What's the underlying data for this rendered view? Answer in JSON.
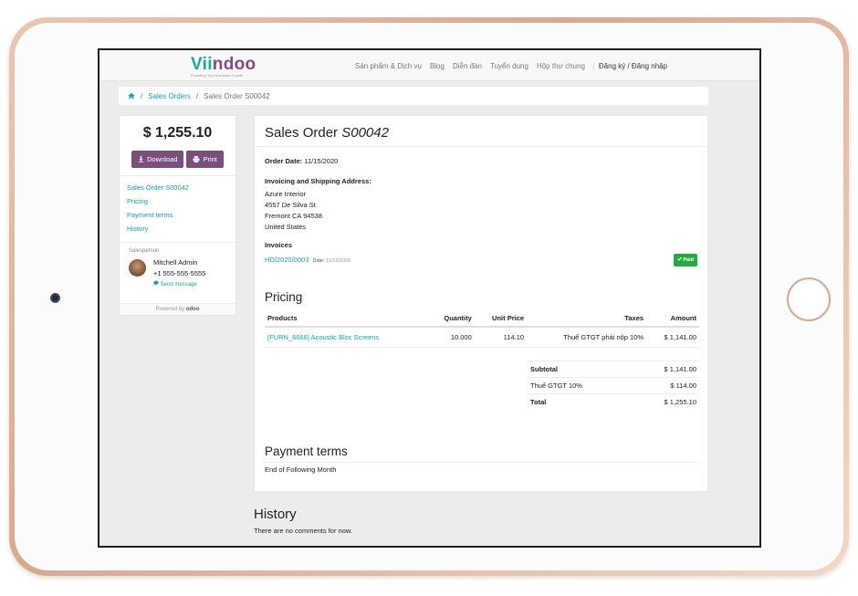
{
  "nav": {
    "logo": "Viindoo",
    "tagline": "Providing Your Business Growth",
    "links": [
      "Sản phẩm & Dịch vụ",
      "Blog",
      "Diễn đàn",
      "Tuyển dụng",
      "Hộp thư chung"
    ],
    "login": "Đăng ký / Đăng nhập"
  },
  "breadcrumb": {
    "home_icon": "home-icon",
    "items": [
      "Sales Orders",
      "Sales Order S00042"
    ]
  },
  "sidebar": {
    "amount": "$ 1,255.10",
    "download_label": "Download",
    "print_label": "Print",
    "links": [
      "Sales Order S00042",
      "Pricing",
      "Payment terms",
      "History"
    ],
    "salesperson_label": "Salesperson",
    "salesperson_name": "Mitchell Admin",
    "salesperson_phone": "+1 555-555-5555",
    "send_message": "Send message",
    "powered_by": "Powered by",
    "powered_brand": "odoo"
  },
  "order": {
    "title_prefix": "Sales Order",
    "number": "S00042",
    "order_date_label": "Order Date:",
    "order_date": "11/15/2020",
    "address_label": "Invoicing and Shipping Address:",
    "address_lines": [
      "Azure Interior",
      "4557 De Silva St",
      "Fremont CA 94538",
      "United States"
    ],
    "invoices_label": "Invoices",
    "invoice_number": "HD/2020/0003",
    "invoice_date_label": "Date:",
    "invoice_date": "11/15/2020",
    "invoice_status": "Paid"
  },
  "pricing": {
    "title": "Pricing",
    "headers": [
      "Products",
      "Quantity",
      "Unit Price",
      "Taxes",
      "Amount"
    ],
    "rows": [
      {
        "product": "[FURN_6666] Acoustic Bloc Screens",
        "quantity": "10.000",
        "unit_price": "114.10",
        "taxes": "Thuế GTGT phải nộp 10%",
        "amount": "$ 1,141.00"
      }
    ],
    "subtotal_label": "Subtotal",
    "subtotal": "$ 1,141.00",
    "tax_label": "Thuế GTGT 10%",
    "tax": "$ 114.00",
    "total_label": "Total",
    "total": "$ 1,255.10"
  },
  "payment_terms": {
    "title": "Payment terms",
    "text": "End of Following Month"
  },
  "history": {
    "title": "History",
    "text": "There are no comments for now."
  },
  "colors": {
    "accent": "#1a9fa3",
    "button": "#7b4e7d",
    "paid": "#28a745"
  }
}
